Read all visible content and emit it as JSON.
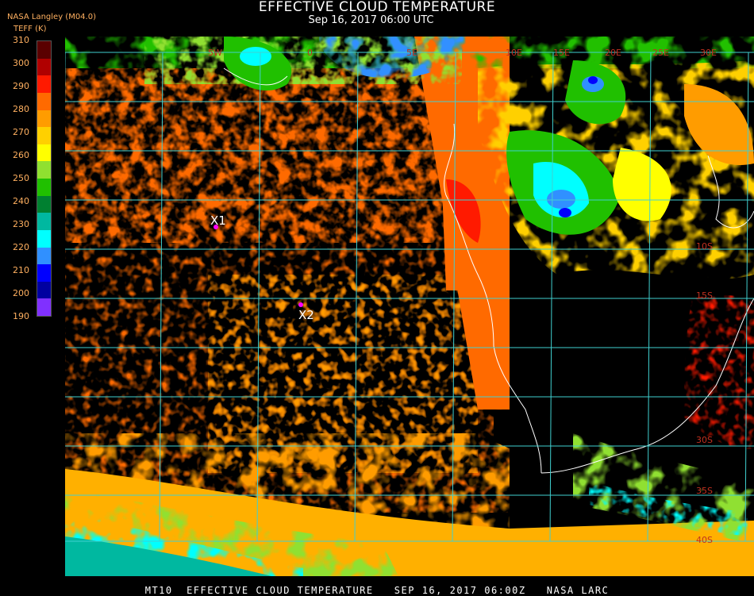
{
  "header": {
    "title": "EFFECTIVE CLOUD TEMPERATURE",
    "subtitle": "Sep 16, 2017 06:00 UTC",
    "source": "NASA Langley (M04.0)",
    "units_label": "TEFF (K)"
  },
  "colorbar": {
    "ticks": [
      "310",
      "300",
      "290",
      "280",
      "270",
      "260",
      "250",
      "240",
      "230",
      "220",
      "210",
      "200",
      "190"
    ],
    "colors": [
      "#5a0000",
      "#b00000",
      "#ff1a00",
      "#ff6a00",
      "#ff9c00",
      "#ffd000",
      "#ffff00",
      "#90e030",
      "#20c000",
      "#008030",
      "#00b8a0",
      "#00ffff",
      "#3090ff",
      "#0000ff",
      "#0000a0",
      "#8030ff"
    ]
  },
  "map": {
    "lon_labels": [
      "5W",
      "0",
      "5E",
      "10E",
      "15E",
      "20E",
      "25E",
      "30E"
    ],
    "lat_labels": [
      "10S",
      "15S",
      "30S",
      "35S",
      "40S"
    ],
    "markers": [
      {
        "label": "X1",
        "color": "#ff00ff"
      },
      {
        "label": "X2",
        "color": "#ff00ff"
      }
    ],
    "grid_color": "#40d0d0"
  },
  "footer": {
    "text": "MT10  EFFECTIVE CLOUD TEMPERATURE   SEP 16, 2017 06:00Z   NASA LARC"
  }
}
